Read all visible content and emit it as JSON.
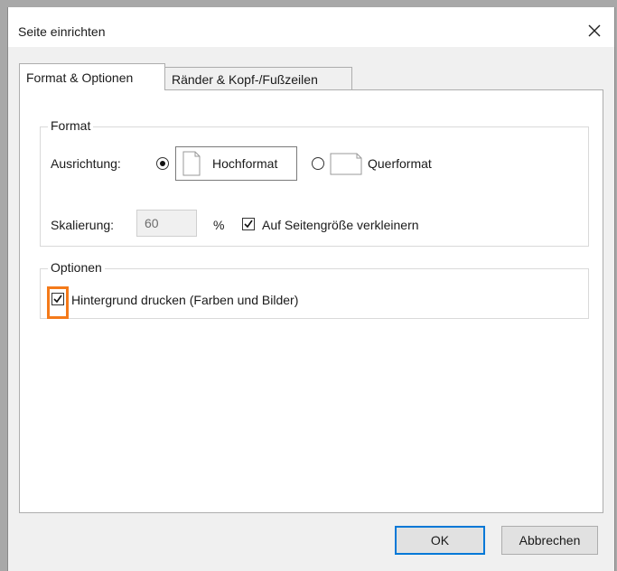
{
  "dialog": {
    "title": "Seite einrichten",
    "close_glyph": "✕"
  },
  "tabs": [
    {
      "label": "Format & Optionen",
      "active": true
    },
    {
      "label": "Ränder & Kopf-/Fußzeilen",
      "active": false
    }
  ],
  "format_group": {
    "legend": "Format",
    "orientation": {
      "label": "Ausrichtung:",
      "options": [
        {
          "label": "Hochformat",
          "selected": true,
          "icon": "portrait-page-icon"
        },
        {
          "label": "Querformat",
          "selected": false,
          "icon": "landscape-page-icon"
        }
      ]
    },
    "scaling": {
      "label": "Skalierung:",
      "value": "60",
      "unit": "%",
      "shrink_to_fit": {
        "label": "Auf Seitengröße verkleinern",
        "checked": true
      }
    }
  },
  "options_group": {
    "legend": "Optionen",
    "print_background": {
      "label": "Hintergrund drucken (Farben und Bilder)",
      "checked": true
    }
  },
  "buttons": {
    "ok": "OK",
    "cancel": "Abbrechen"
  },
  "colors": {
    "highlight": "#f47a1a",
    "default_button_border": "#0078d7"
  }
}
